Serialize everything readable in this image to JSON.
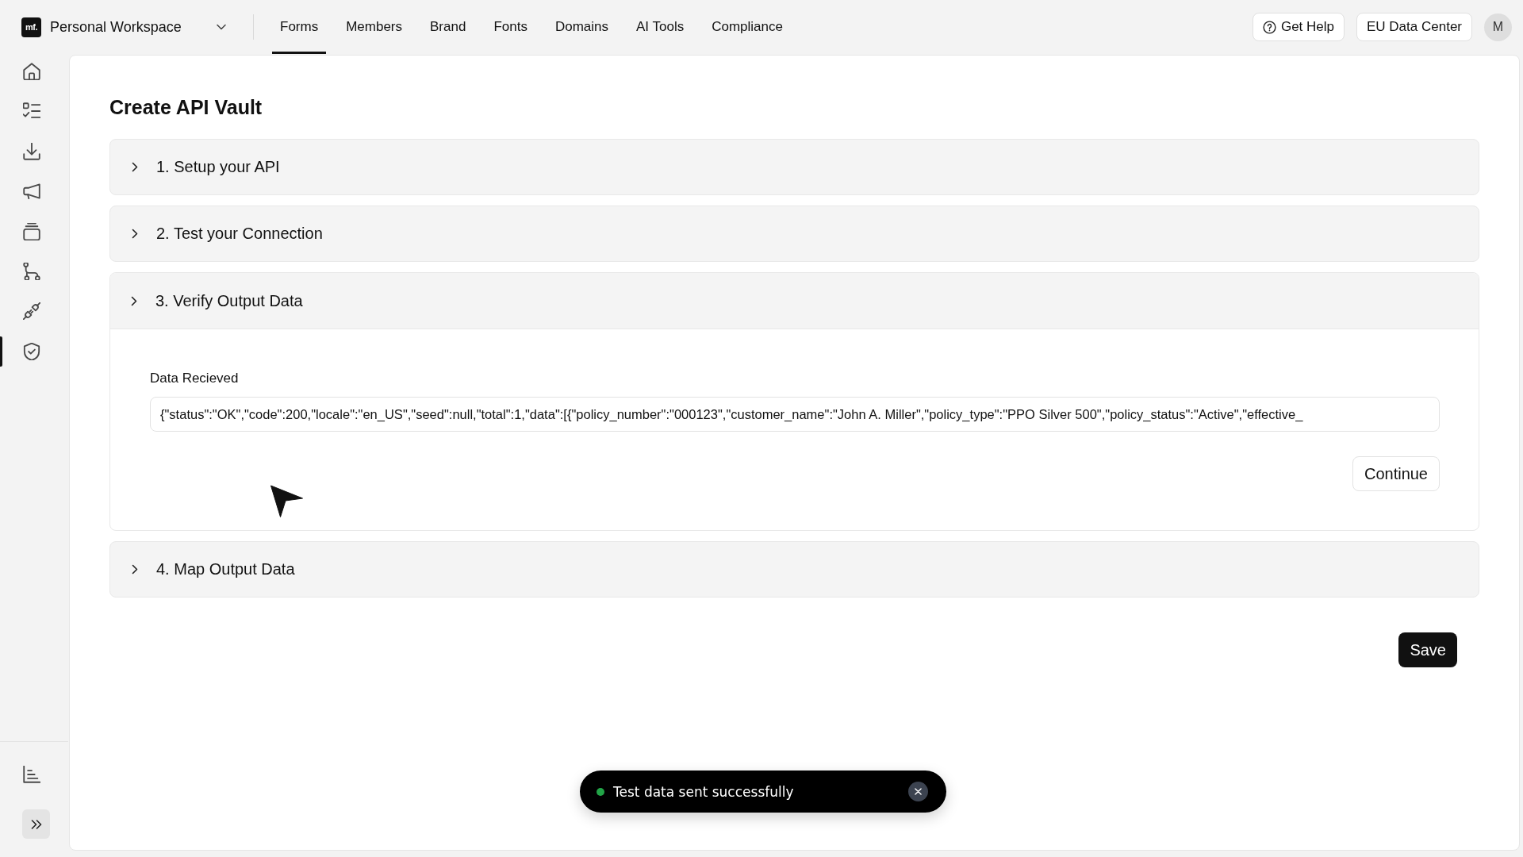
{
  "header": {
    "logo_text": "mf.",
    "workspace": "Personal Workspace",
    "tabs": [
      {
        "label": "Forms",
        "selected": true
      },
      {
        "label": "Members",
        "selected": false
      },
      {
        "label": "Brand",
        "selected": false
      },
      {
        "label": "Fonts",
        "selected": false
      },
      {
        "label": "Domains",
        "selected": false
      },
      {
        "label": "AI Tools",
        "selected": false
      },
      {
        "label": "Compliance",
        "selected": false
      }
    ],
    "help_button": "Get Help",
    "region_button": "EU Data Center",
    "avatar": "M"
  },
  "sidebar": {
    "items": [
      {
        "selected": false
      },
      {
        "selected": false
      },
      {
        "selected": false
      },
      {
        "selected": false
      },
      {
        "selected": false
      },
      {
        "selected": false
      },
      {
        "selected": false
      },
      {
        "selected": true
      }
    ]
  },
  "page": {
    "title": "Create API Vault",
    "sections": [
      {
        "title": "1. Setup your API",
        "expanded": false
      },
      {
        "title": "2. Test your Connection",
        "expanded": false
      },
      {
        "title": "3. Verify Output Data",
        "expanded": true,
        "field_label": "Data Recieved",
        "field_value": "{\"status\":\"OK\",\"code\":200,\"locale\":\"en_US\",\"seed\":null,\"total\":1,\"data\":[{\"policy_number\":\"000123\",\"customer_name\":\"John A. Miller\",\"policy_type\":\"PPO Silver 500\",\"policy_status\":\"Active\",\"effective_",
        "button": "Continue"
      },
      {
        "title": "4. Map Output Data",
        "expanded": false
      }
    ],
    "save_button": "Save"
  },
  "toast": {
    "message": "Test data sent successfully"
  }
}
